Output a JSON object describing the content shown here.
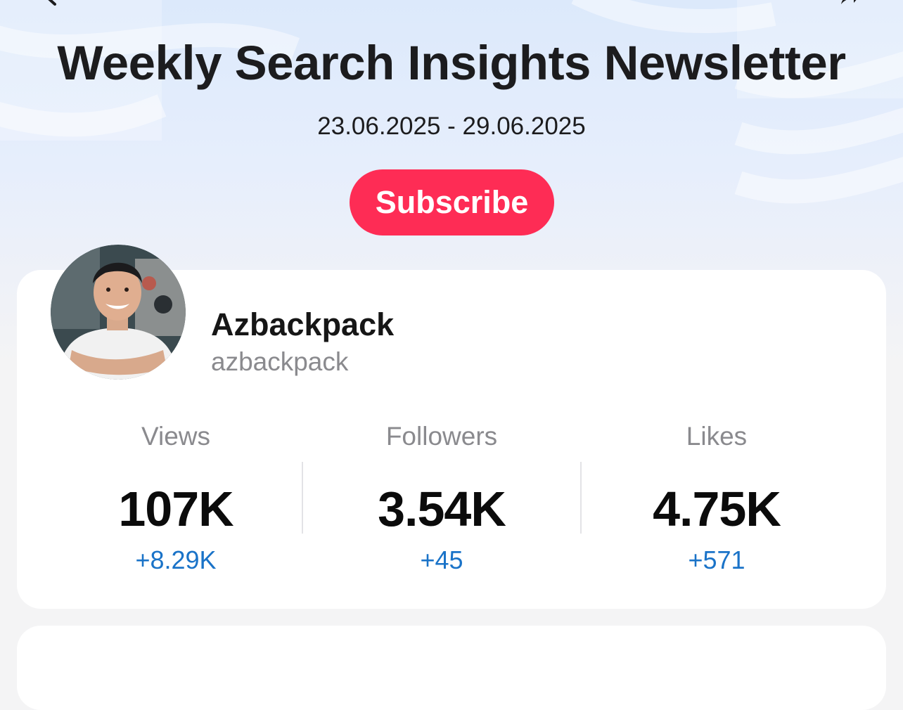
{
  "header": {
    "title": "Weekly Search Insights Newsletter",
    "date_range": "23.06.2025 - 29.06.2025",
    "subscribe_label": "Subscribe",
    "accent_color": "#fe2c55",
    "back_icon": "chevron-left-icon",
    "share_icon": "share-arrow-icon"
  },
  "profile": {
    "display_name": "Azbackpack",
    "username": "azbackpack",
    "avatar_icon": "user-avatar"
  },
  "stats": [
    {
      "label": "Views",
      "value": "107K",
      "delta": "+8.29K"
    },
    {
      "label": "Followers",
      "value": "3.54K",
      "delta": "+45"
    },
    {
      "label": "Likes",
      "value": "4.75K",
      "delta": "+571"
    }
  ],
  "colors": {
    "delta": "#1a73c8",
    "card": "#ffffff",
    "background": "#f4f4f5"
  }
}
